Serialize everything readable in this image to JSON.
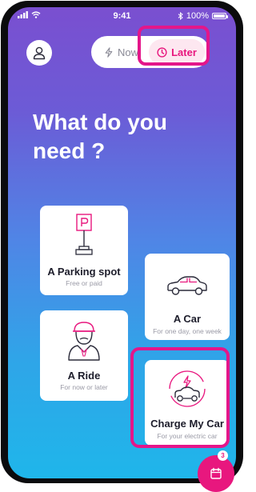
{
  "status_bar": {
    "time": "9:41",
    "battery": "100%",
    "battery_level": 1.0
  },
  "mode_toggle": {
    "now_label": "Now",
    "later_label": "Later",
    "selected": "Later"
  },
  "heading": {
    "line1": "What do you",
    "line2": "need ?"
  },
  "cards": [
    {
      "title": "A Parking spot",
      "subtitle": "Free or paid",
      "icon": "parking-sign-icon"
    },
    {
      "title": "A Car",
      "subtitle": "For one day, one week",
      "icon": "car-icon"
    },
    {
      "title": "A Ride",
      "subtitle": "For now or later",
      "icon": "driver-icon"
    },
    {
      "title": "Charge My Car",
      "subtitle": "For your electric car",
      "icon": "electric-car-icon"
    }
  ],
  "calendar_button": {
    "badge": "3",
    "icon": "calendar-icon"
  },
  "colors": {
    "accent": "#e8177e",
    "highlight": "#e4168a",
    "gradient_top": "#7a4fd0",
    "gradient_bottom": "#1fb6ea"
  }
}
